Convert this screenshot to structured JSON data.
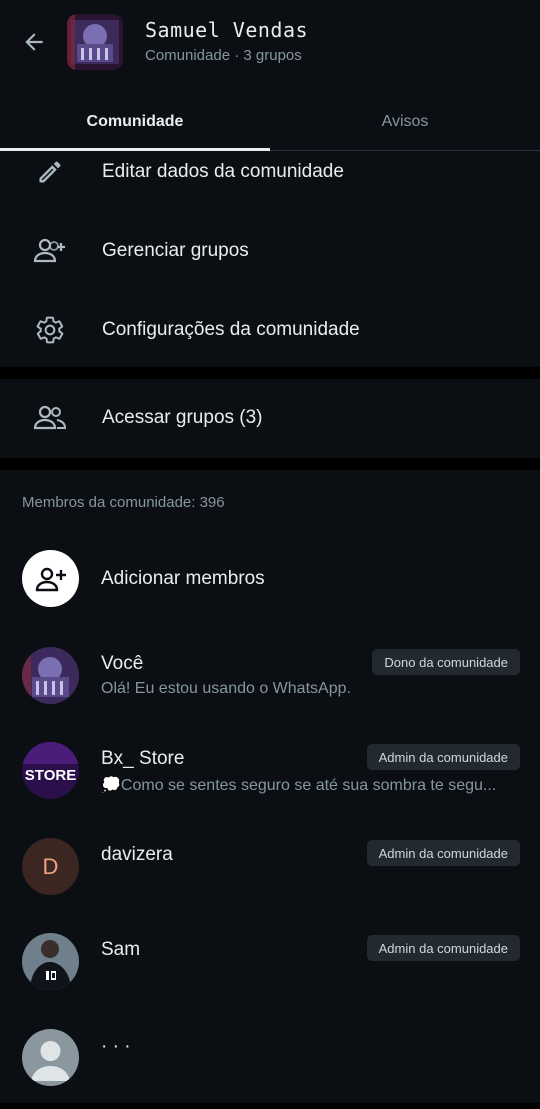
{
  "header": {
    "title": "Samuel Vendas",
    "subtitle": "Comunidade · 3 grupos",
    "back_icon": "arrow-left-icon"
  },
  "tabs": [
    {
      "label": "Comunidade",
      "active": true
    },
    {
      "label": "Avisos",
      "active": false
    }
  ],
  "menu": {
    "edit": {
      "label": "Editar dados da comunidade",
      "icon": "pencil-icon"
    },
    "manage": {
      "label": "Gerenciar grupos",
      "icon": "group-add-icon"
    },
    "settings": {
      "label": "Configurações da comunidade",
      "icon": "gear-icon"
    },
    "access": {
      "label": "Acessar grupos (3)",
      "icon": "group-icon"
    }
  },
  "members": {
    "section_label": "Membros da comunidade: 396",
    "add_label": "Adicionar membros",
    "list": [
      {
        "name": "Você",
        "status": "Olá! Eu estou usando o WhatsApp.",
        "badge": "Dono da comunidade"
      },
      {
        "name": "Bx_ Store",
        "status": "💭Como se sentes seguro se até sua sombra te segu...",
        "badge": "Admin da comunidade",
        "avatar_text": "STORE"
      },
      {
        "name": "davizera",
        "status": "",
        "badge": "Admin da comunidade",
        "avatar_letter": "D"
      },
      {
        "name": "Sam",
        "status": "",
        "badge": "Admin da comunidade"
      },
      {
        "name": "· · ·",
        "status": "",
        "badge": ""
      }
    ]
  },
  "colors": {
    "background": "#0b0f14",
    "secondary_text": "#8696a0",
    "badge_bg": "#222a30"
  }
}
